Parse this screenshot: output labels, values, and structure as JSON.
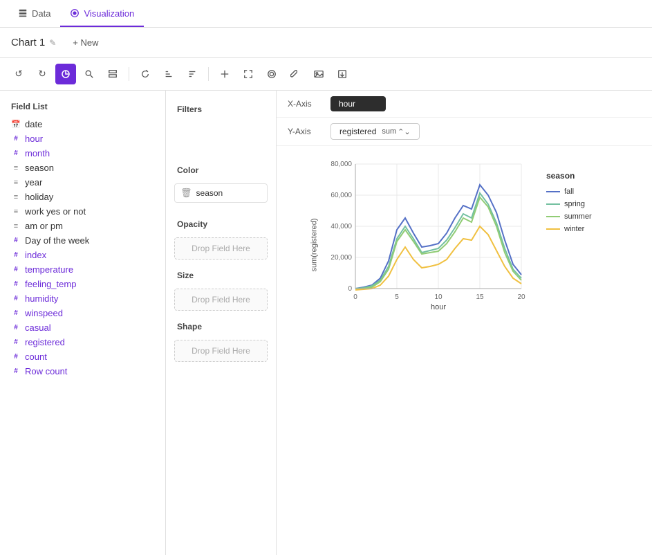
{
  "nav": {
    "tabs": [
      {
        "id": "data",
        "label": "Data",
        "icon": "data-icon",
        "active": false
      },
      {
        "id": "visualization",
        "label": "Visualization",
        "icon": "visualization-icon",
        "active": true
      }
    ]
  },
  "header": {
    "chart_title": "Chart 1",
    "edit_label": "✎",
    "new_label": "+ New"
  },
  "toolbar": {
    "buttons": [
      {
        "id": "undo",
        "icon": "↺",
        "active": false
      },
      {
        "id": "redo",
        "icon": "↻",
        "active": false
      },
      {
        "id": "chart-type",
        "icon": "◉",
        "active": true
      },
      {
        "id": "search",
        "icon": "🔍",
        "active": false
      },
      {
        "id": "layers",
        "icon": "⊞",
        "active": false
      },
      {
        "id": "refresh",
        "icon": "⟳",
        "active": false
      },
      {
        "id": "sort-asc",
        "icon": "↑",
        "active": false
      },
      {
        "id": "sort-desc",
        "icon": "↓",
        "active": false
      },
      {
        "id": "arrange",
        "icon": "⇅",
        "active": false
      },
      {
        "id": "fullscreen",
        "icon": "⛶",
        "active": false
      },
      {
        "id": "interact",
        "icon": "⊕",
        "active": false
      },
      {
        "id": "wrench",
        "icon": "🔧",
        "active": false
      },
      {
        "id": "image",
        "icon": "🖼",
        "active": false
      },
      {
        "id": "export",
        "icon": "⊡",
        "active": false
      }
    ]
  },
  "field_list": {
    "title": "Field List",
    "fields": [
      {
        "name": "date",
        "type": "date",
        "typeLabel": "📅",
        "purple": false
      },
      {
        "name": "hour",
        "type": "number",
        "typeLabel": "#",
        "purple": true
      },
      {
        "name": "month",
        "type": "number",
        "typeLabel": "#",
        "purple": true
      },
      {
        "name": "season",
        "type": "text",
        "typeLabel": "≡",
        "purple": false
      },
      {
        "name": "year",
        "type": "text",
        "typeLabel": "≡",
        "purple": false
      },
      {
        "name": "holiday",
        "type": "text",
        "typeLabel": "≡",
        "purple": false
      },
      {
        "name": "work yes or not",
        "type": "text",
        "typeLabel": "≡",
        "purple": false
      },
      {
        "name": "am or pm",
        "type": "text",
        "typeLabel": "≡",
        "purple": false
      },
      {
        "name": "Day of the week",
        "type": "number",
        "typeLabel": "#",
        "purple": false
      },
      {
        "name": "index",
        "type": "number",
        "typeLabel": "#",
        "purple": true
      },
      {
        "name": "temperature",
        "type": "number",
        "typeLabel": "#",
        "purple": true
      },
      {
        "name": "feeling_temp",
        "type": "number",
        "typeLabel": "#",
        "purple": true
      },
      {
        "name": "humidity",
        "type": "number",
        "typeLabel": "#",
        "purple": true
      },
      {
        "name": "winspeed",
        "type": "number",
        "typeLabel": "#",
        "purple": true
      },
      {
        "name": "casual",
        "type": "number",
        "typeLabel": "#",
        "purple": true
      },
      {
        "name": "registered",
        "type": "number",
        "typeLabel": "#",
        "purple": true
      },
      {
        "name": "count",
        "type": "number",
        "typeLabel": "#",
        "purple": true
      },
      {
        "name": "Row count",
        "type": "number",
        "typeLabel": "#",
        "purple": true
      }
    ]
  },
  "filters": {
    "title": "Filters"
  },
  "color": {
    "title": "Color",
    "value": "season"
  },
  "opacity": {
    "title": "Opacity",
    "drop_label": "Drop Field Here"
  },
  "size": {
    "title": "Size",
    "drop_label": "Drop Field Here"
  },
  "shape": {
    "title": "Shape",
    "drop_label": "Drop Field Here"
  },
  "x_axis": {
    "label": "X-Axis",
    "value": "hour"
  },
  "y_axis": {
    "label": "Y-Axis",
    "field": "registered",
    "aggregation": "sum"
  },
  "chart": {
    "x_label": "hour",
    "y_label": "sum(registered)",
    "x_ticks": [
      "0",
      "5",
      "10",
      "15",
      "20"
    ],
    "y_ticks": [
      "0",
      "20,000",
      "40,000",
      "60,000",
      "80,000"
    ],
    "legend_title": "season",
    "legend": [
      {
        "label": "fall",
        "color": "#5470c6"
      },
      {
        "label": "spring",
        "color": "#73c0a0"
      },
      {
        "label": "summer",
        "color": "#91cc75"
      },
      {
        "label": "winter",
        "color": "#f0c040"
      }
    ]
  }
}
